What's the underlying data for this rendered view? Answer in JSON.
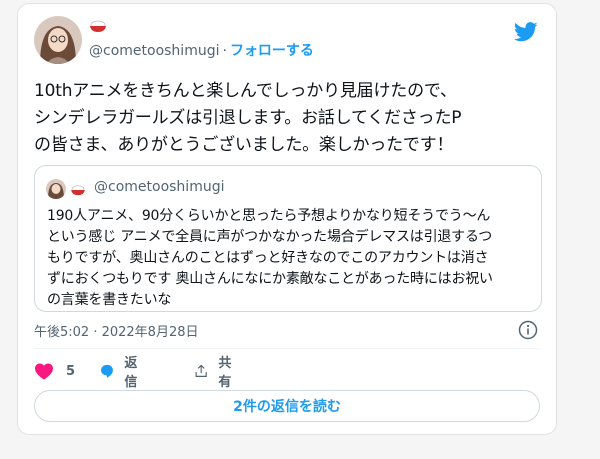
{
  "tweet": {
    "handle": "@cometooshimugi",
    "separator": "·",
    "follow_label": "フォローする",
    "text": "10thアニメをきちんと楽しんでしっかり見届けたので、\nシンデレラガールズは引退します。お話してくださったP\nの皆さま、ありがとうございました。楽しかったです！",
    "timestamp": "午後5:02 · 2022年8月28日"
  },
  "quoted": {
    "handle": "@cometooshimugi",
    "text": "190人アニメ、90分くらいかと思ったら予想よりかなり短そうでう～ん\nという感じ アニメで全員に声がつかなかった場合デレマスは引退するつ\nもりですが、奥山さんのことはずっと好きなのでこのアカウントは消さ\nずにおくつもりです 奥山さんになにか素敵なことがあった時にはお祝い\nの言葉を書きたいな"
  },
  "actions": {
    "like_count": "5",
    "reply_label": "返信",
    "share_label": "共有"
  },
  "replies_button_label": "2件の返信を読む",
  "icons": {
    "brand": "twitter-bird-icon",
    "like": "heart-icon",
    "reply": "speech-bubble-icon",
    "share": "share-icon",
    "info": "info-icon",
    "name_emoji": "rice-bowl-emoji"
  },
  "colors": {
    "accent": "#1d9bf0",
    "like": "#f91880",
    "text": "#0f1419",
    "secondary": "#536471"
  }
}
